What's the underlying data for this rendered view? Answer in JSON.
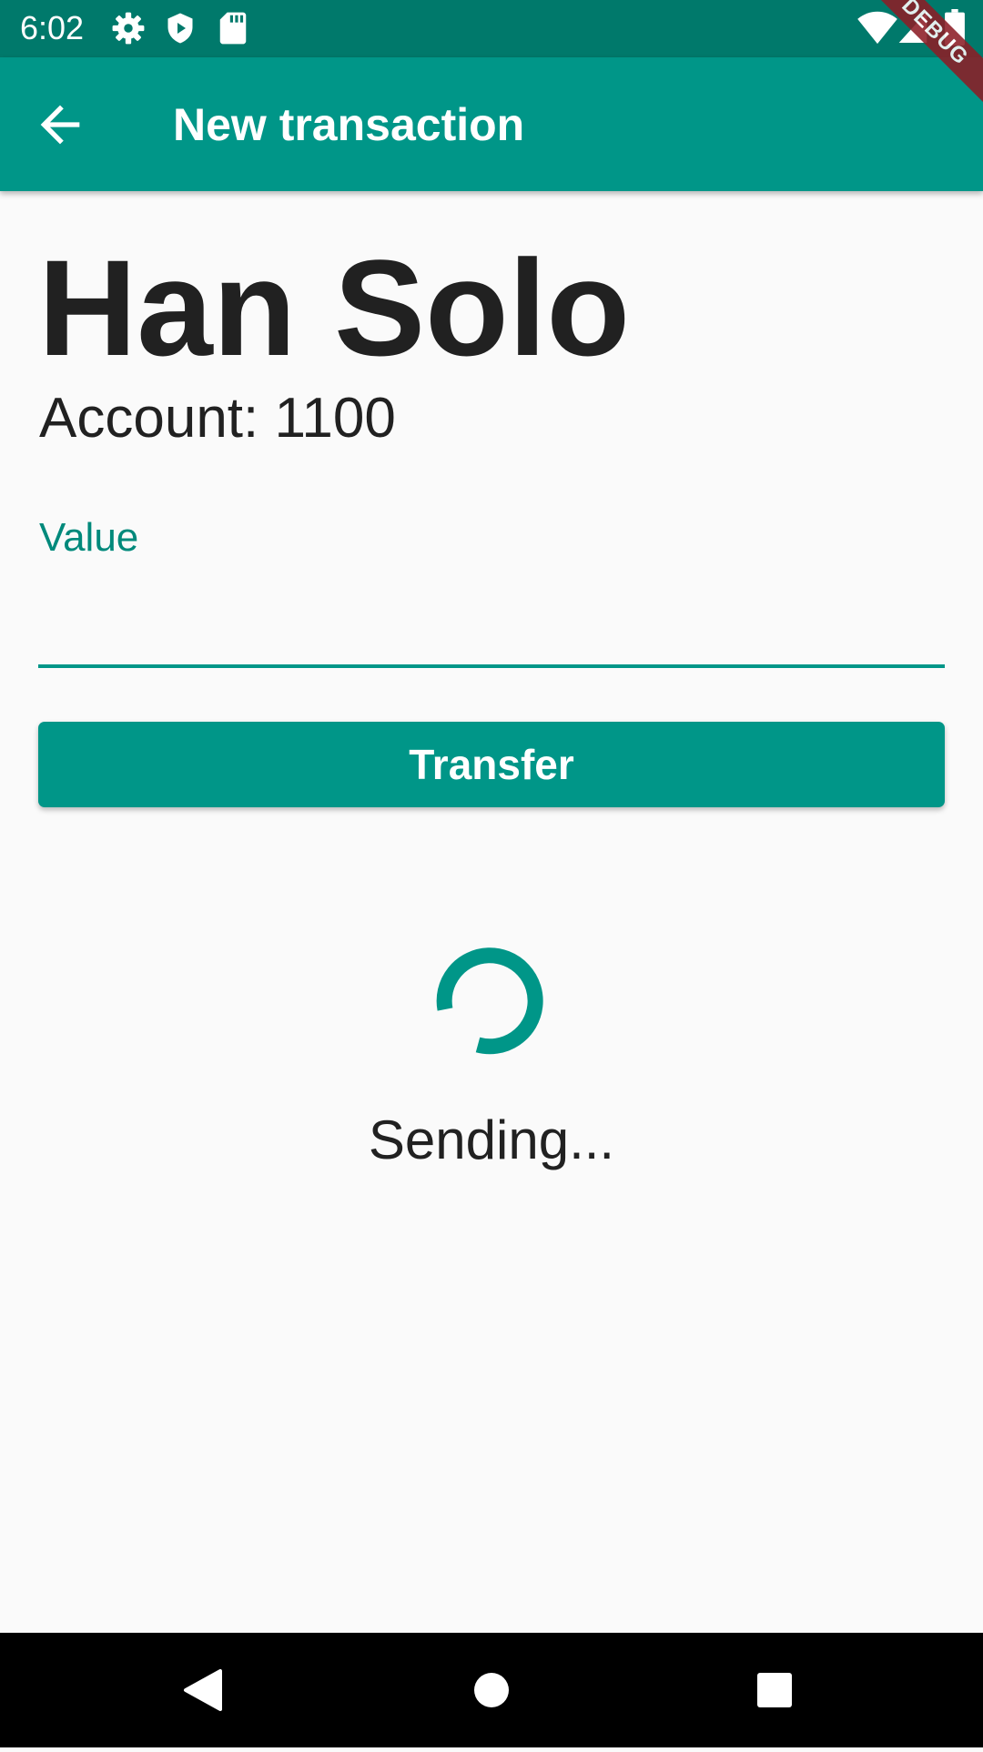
{
  "status_bar": {
    "time": "6:02",
    "left_icons": [
      "settings-icon",
      "play-shield-icon",
      "sd-card-icon"
    ],
    "right_icons": [
      "wifi-icon",
      "cell-signal-icon",
      "battery-icon"
    ]
  },
  "debug_ribbon": {
    "label": "DEBUG"
  },
  "app_bar": {
    "title": "New transaction",
    "back_icon": "arrow-back-icon",
    "color": "#009688"
  },
  "contact": {
    "name": "Han Solo",
    "account": "Account: 1100"
  },
  "form": {
    "value_label": "Value",
    "value": "",
    "transfer_label": "Transfer"
  },
  "progress": {
    "message": "Sending...",
    "indicator": "spinner"
  },
  "nav_bar": {
    "buttons": [
      "back-triangle-icon",
      "home-circle-icon",
      "recents-square-icon"
    ]
  },
  "colors": {
    "primary": "#009688",
    "primary_dark": "#00796b",
    "accent": "#009688",
    "text": "#212121",
    "background": "#fafafa"
  }
}
